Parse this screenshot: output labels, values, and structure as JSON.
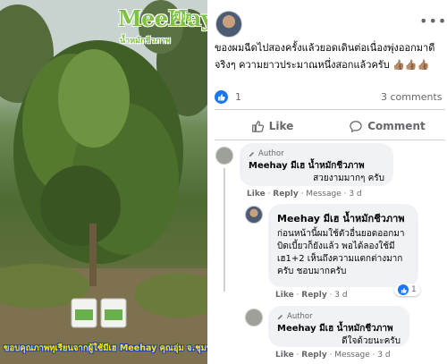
{
  "photo": {
    "brand_name": "MeeHay",
    "brand_thai": "มีเฮ",
    "brand_tagline": "น้ำหมักชีวภาพ",
    "caption": "ขอบคุณภาพทุเรียนจากผู้ใช้มีเฮ Meehay คุณอุ่ม จ.ชุมพร"
  },
  "post": {
    "text": "ของผมฉีดไปสองครั้งแล้วยอดเดินต่อเนื่องพุ่งออกมาดีจริงๆ ความยาวประมาณหนึ่งสอกแล้วครับ",
    "emoji": "👍🏽👍🏽👍🏽",
    "more_label": "•••",
    "reaction_count": "1",
    "comments_label": "3 comments",
    "like_label": "Like",
    "comment_label": "Comment"
  },
  "comments": [
    {
      "author_badge": "Author",
      "name": "Meehay มีเฮ น้ำหมักชีวภาพ",
      "text": "สวยงามมากๆ ครับ",
      "like": "Like",
      "reply": "Reply",
      "message": "Message",
      "time": "3 d"
    },
    {
      "name": "Meehay มีเฮ น้ำหมักชีวภาพ",
      "text": "ก่อนหน้านี้ผมใช้ตัวอื่นยอดออกมาบิดเบี้ยวก็ยังแล้ว พอได้ลองใช้มีเฮ1+2 เห็นถึงความแตกต่างมากครับ ชอบมากครับ",
      "like": "Like",
      "reply": "Reply",
      "time": "3 d",
      "reactions": "1"
    },
    {
      "author_badge": "Author",
      "name": "Meehay มีเฮ น้ำหมักชีวภาพ",
      "text": "ดีใจด้วยนะครับ",
      "like": "Like",
      "reply": "Reply",
      "message": "Message",
      "time": "3 d"
    }
  ],
  "colors": {
    "facebook_blue": "#1877f2",
    "bubble_gray": "#f0f2f5",
    "meta_gray": "#65676b",
    "brand_green": "#7dc242"
  }
}
